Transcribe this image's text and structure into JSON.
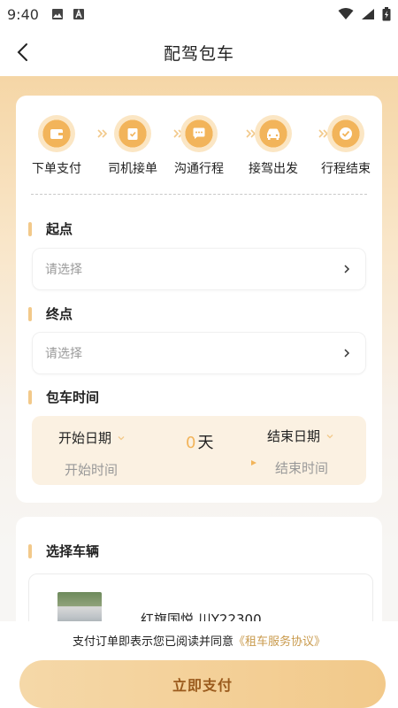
{
  "status_bar": {
    "time": "9:40",
    "icons_left": [
      "image-icon",
      "text-a-icon"
    ],
    "icons_right": [
      "wifi-icon",
      "signal-icon",
      "battery-icon"
    ]
  },
  "nav": {
    "title": "配驾包车",
    "back_icon": "chevron-left-icon"
  },
  "steps": [
    {
      "label": "下单支付",
      "icon": "wallet-icon"
    },
    {
      "label": "司机接单",
      "icon": "clipboard-check-icon"
    },
    {
      "label": "沟通行程",
      "icon": "chat-icon"
    },
    {
      "label": "接驾出发",
      "icon": "car-icon"
    },
    {
      "label": "行程结束",
      "icon": "check-circle-icon"
    }
  ],
  "start": {
    "title": "起点",
    "placeholder": "请选择"
  },
  "end": {
    "title": "终点",
    "placeholder": "请选择"
  },
  "rental_time": {
    "title": "包车时间",
    "start_date_label": "开始日期",
    "start_time_label": "开始时间",
    "end_date_label": "结束日期",
    "end_time_label": "结束时间",
    "days_value": "0",
    "days_unit": "天"
  },
  "vehicle": {
    "title": "选择车辆",
    "name": "红旗国悦 川Y22300"
  },
  "footer": {
    "agreement_text": "支付订单即表示您已阅读并同意",
    "agreement_link": "《租车服务协议》",
    "pay_button": "立即支付"
  },
  "colors": {
    "accent": "#f2b45a",
    "accent_light": "#fbe6c4",
    "button_text": "#9a5a1c",
    "link": "#c99a4c"
  }
}
